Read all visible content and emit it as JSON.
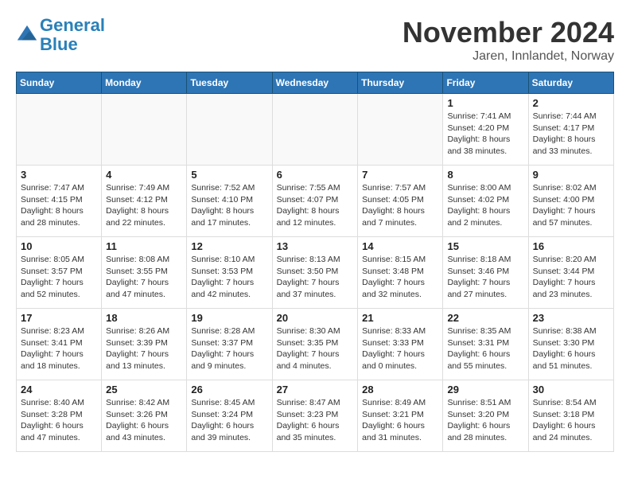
{
  "logo": {
    "line1": "General",
    "line2": "Blue"
  },
  "title": "November 2024",
  "location": "Jaren, Innlandet, Norway",
  "days_of_week": [
    "Sunday",
    "Monday",
    "Tuesday",
    "Wednesday",
    "Thursday",
    "Friday",
    "Saturday"
  ],
  "weeks": [
    [
      {
        "day": "",
        "info": ""
      },
      {
        "day": "",
        "info": ""
      },
      {
        "day": "",
        "info": ""
      },
      {
        "day": "",
        "info": ""
      },
      {
        "day": "",
        "info": ""
      },
      {
        "day": "1",
        "info": "Sunrise: 7:41 AM\nSunset: 4:20 PM\nDaylight: 8 hours and 38 minutes."
      },
      {
        "day": "2",
        "info": "Sunrise: 7:44 AM\nSunset: 4:17 PM\nDaylight: 8 hours and 33 minutes."
      }
    ],
    [
      {
        "day": "3",
        "info": "Sunrise: 7:47 AM\nSunset: 4:15 PM\nDaylight: 8 hours and 28 minutes."
      },
      {
        "day": "4",
        "info": "Sunrise: 7:49 AM\nSunset: 4:12 PM\nDaylight: 8 hours and 22 minutes."
      },
      {
        "day": "5",
        "info": "Sunrise: 7:52 AM\nSunset: 4:10 PM\nDaylight: 8 hours and 17 minutes."
      },
      {
        "day": "6",
        "info": "Sunrise: 7:55 AM\nSunset: 4:07 PM\nDaylight: 8 hours and 12 minutes."
      },
      {
        "day": "7",
        "info": "Sunrise: 7:57 AM\nSunset: 4:05 PM\nDaylight: 8 hours and 7 minutes."
      },
      {
        "day": "8",
        "info": "Sunrise: 8:00 AM\nSunset: 4:02 PM\nDaylight: 8 hours and 2 minutes."
      },
      {
        "day": "9",
        "info": "Sunrise: 8:02 AM\nSunset: 4:00 PM\nDaylight: 7 hours and 57 minutes."
      }
    ],
    [
      {
        "day": "10",
        "info": "Sunrise: 8:05 AM\nSunset: 3:57 PM\nDaylight: 7 hours and 52 minutes."
      },
      {
        "day": "11",
        "info": "Sunrise: 8:08 AM\nSunset: 3:55 PM\nDaylight: 7 hours and 47 minutes."
      },
      {
        "day": "12",
        "info": "Sunrise: 8:10 AM\nSunset: 3:53 PM\nDaylight: 7 hours and 42 minutes."
      },
      {
        "day": "13",
        "info": "Sunrise: 8:13 AM\nSunset: 3:50 PM\nDaylight: 7 hours and 37 minutes."
      },
      {
        "day": "14",
        "info": "Sunrise: 8:15 AM\nSunset: 3:48 PM\nDaylight: 7 hours and 32 minutes."
      },
      {
        "day": "15",
        "info": "Sunrise: 8:18 AM\nSunset: 3:46 PM\nDaylight: 7 hours and 27 minutes."
      },
      {
        "day": "16",
        "info": "Sunrise: 8:20 AM\nSunset: 3:44 PM\nDaylight: 7 hours and 23 minutes."
      }
    ],
    [
      {
        "day": "17",
        "info": "Sunrise: 8:23 AM\nSunset: 3:41 PM\nDaylight: 7 hours and 18 minutes."
      },
      {
        "day": "18",
        "info": "Sunrise: 8:26 AM\nSunset: 3:39 PM\nDaylight: 7 hours and 13 minutes."
      },
      {
        "day": "19",
        "info": "Sunrise: 8:28 AM\nSunset: 3:37 PM\nDaylight: 7 hours and 9 minutes."
      },
      {
        "day": "20",
        "info": "Sunrise: 8:30 AM\nSunset: 3:35 PM\nDaylight: 7 hours and 4 minutes."
      },
      {
        "day": "21",
        "info": "Sunrise: 8:33 AM\nSunset: 3:33 PM\nDaylight: 7 hours and 0 minutes."
      },
      {
        "day": "22",
        "info": "Sunrise: 8:35 AM\nSunset: 3:31 PM\nDaylight: 6 hours and 55 minutes."
      },
      {
        "day": "23",
        "info": "Sunrise: 8:38 AM\nSunset: 3:30 PM\nDaylight: 6 hours and 51 minutes."
      }
    ],
    [
      {
        "day": "24",
        "info": "Sunrise: 8:40 AM\nSunset: 3:28 PM\nDaylight: 6 hours and 47 minutes."
      },
      {
        "day": "25",
        "info": "Sunrise: 8:42 AM\nSunset: 3:26 PM\nDaylight: 6 hours and 43 minutes."
      },
      {
        "day": "26",
        "info": "Sunrise: 8:45 AM\nSunset: 3:24 PM\nDaylight: 6 hours and 39 minutes."
      },
      {
        "day": "27",
        "info": "Sunrise: 8:47 AM\nSunset: 3:23 PM\nDaylight: 6 hours and 35 minutes."
      },
      {
        "day": "28",
        "info": "Sunrise: 8:49 AM\nSunset: 3:21 PM\nDaylight: 6 hours and 31 minutes."
      },
      {
        "day": "29",
        "info": "Sunrise: 8:51 AM\nSunset: 3:20 PM\nDaylight: 6 hours and 28 minutes."
      },
      {
        "day": "30",
        "info": "Sunrise: 8:54 AM\nSunset: 3:18 PM\nDaylight: 6 hours and 24 minutes."
      }
    ]
  ]
}
